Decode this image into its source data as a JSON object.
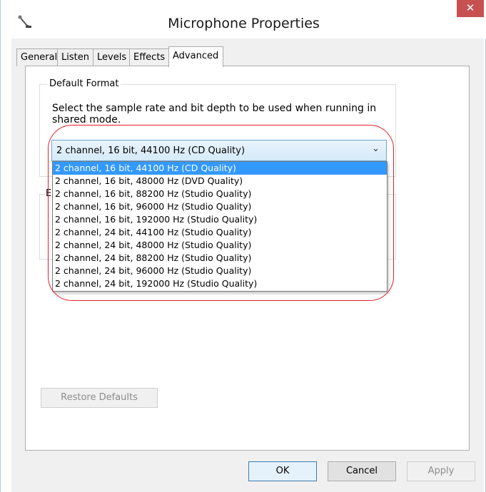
{
  "window": {
    "title": "Microphone Properties",
    "close_label": "✕"
  },
  "tabs": [
    {
      "label": "General"
    },
    {
      "label": "Listen"
    },
    {
      "label": "Levels"
    },
    {
      "label": "Effects"
    },
    {
      "label": "Advanced",
      "active": true
    }
  ],
  "default_format": {
    "group_label": "Default Format",
    "description": "Select the sample rate and bit depth to be used when running in shared mode.",
    "selected_value": "2 channel, 16 bit, 44100 Hz (CD Quality)",
    "options": [
      "2 channel, 16 bit, 44100 Hz (CD Quality)",
      "2 channel, 16 bit, 48000 Hz (DVD Quality)",
      "2 channel, 16 bit, 88200 Hz (Studio Quality)",
      "2 channel, 16 bit, 96000 Hz (Studio Quality)",
      "2 channel, 16 bit, 192000 Hz (Studio Quality)",
      "2 channel, 24 bit, 44100 Hz (Studio Quality)",
      "2 channel, 24 bit, 48000 Hz (Studio Quality)",
      "2 channel, 24 bit, 88200 Hz (Studio Quality)",
      "2 channel, 24 bit, 96000 Hz (Studio Quality)",
      "2 channel, 24 bit, 192000 Hz (Studio Quality)"
    ]
  },
  "partially_hidden_label": "E",
  "buttons": {
    "restore_defaults": "Restore Defaults",
    "ok": "OK",
    "cancel": "Cancel",
    "apply": "Apply"
  },
  "colors": {
    "highlight": "#3399ff",
    "close_button": "#c75050",
    "annotation": "#e0202a"
  }
}
